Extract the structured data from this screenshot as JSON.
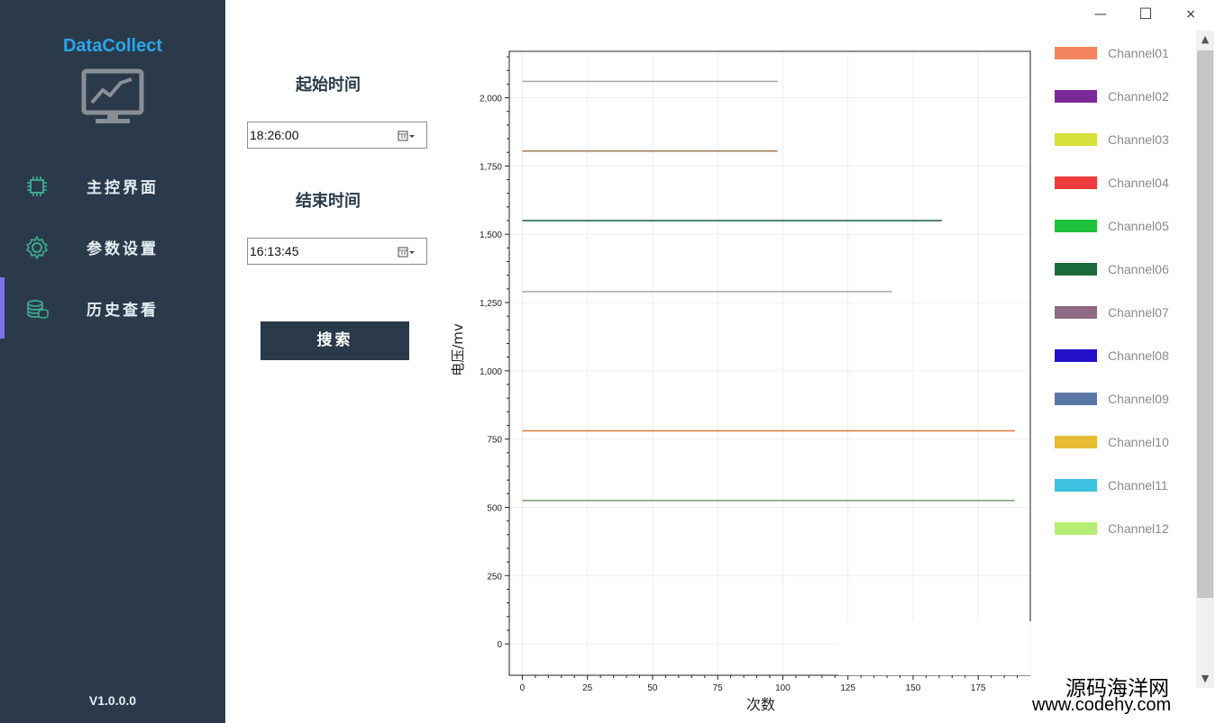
{
  "app": {
    "title": "DataCollect",
    "version": "V1.0.0.0"
  },
  "window": {
    "minimize": "—",
    "maximize": "☐",
    "close": "×"
  },
  "nav": [
    {
      "label": "主控界面",
      "icon": "chip-icon",
      "active": false
    },
    {
      "label": "参数设置",
      "icon": "gear-icon",
      "active": false
    },
    {
      "label": "历史查看",
      "icon": "database-icon",
      "active": true
    }
  ],
  "filter": {
    "start_label": "起始时间",
    "start_value": "18:26:00",
    "end_label": "结束时间",
    "end_value": "16:13:45",
    "search_label": "搜索"
  },
  "chart_data": {
    "type": "line",
    "xlabel": "次数",
    "ylabel": "电压/mv",
    "xlim": [
      -5,
      195
    ],
    "ylim": [
      -115,
      2170
    ],
    "xticks": [
      0,
      25,
      50,
      75,
      100,
      125,
      150,
      175
    ],
    "yticks": [
      0,
      250,
      500,
      750,
      1000,
      1250,
      1500,
      1750,
      2000
    ],
    "ytick_labels": [
      "0",
      "250",
      "500",
      "750",
      "1,000",
      "1,250",
      "1,500",
      "1,750",
      "2,000"
    ],
    "grid": true,
    "series": [
      {
        "color": "#a8a8a8",
        "x": [
          0,
          98
        ],
        "y": [
          2060,
          2060
        ]
      },
      {
        "color": "#a07a5a",
        "x": [
          0,
          98
        ],
        "y": [
          1805,
          1805
        ]
      },
      {
        "color": "#1e5a3a",
        "x": [
          0,
          161
        ],
        "y": [
          1550,
          1550
        ]
      },
      {
        "color": "#a8a8b0",
        "x": [
          0,
          142
        ],
        "y": [
          1290,
          1290
        ]
      },
      {
        "color": "#e0763a",
        "x": [
          0,
          189
        ],
        "y": [
          780,
          780
        ]
      },
      {
        "color": "#7a9a6a",
        "x": [
          0,
          189
        ],
        "y": [
          525,
          525
        ]
      }
    ]
  },
  "legend": [
    {
      "label": "Channel01",
      "color": "#f4845f"
    },
    {
      "label": "Channel02",
      "color": "#7b2a98"
    },
    {
      "label": "Channel03",
      "color": "#d6e13c"
    },
    {
      "label": "Channel04",
      "color": "#ee3a3a"
    },
    {
      "label": "Channel05",
      "color": "#1fc13c"
    },
    {
      "label": "Channel06",
      "color": "#1a6a3c"
    },
    {
      "label": "Channel07",
      "color": "#8e6a84"
    },
    {
      "label": "Channel08",
      "color": "#2410c8"
    },
    {
      "label": "Channel09",
      "color": "#5b77a8"
    },
    {
      "label": "Channel10",
      "color": "#e8bb34"
    },
    {
      "label": "Channel11",
      "color": "#3cc2e0"
    },
    {
      "label": "Channel12",
      "color": "#b6ee74"
    }
  ],
  "watermark": {
    "cn": "源码海洋网",
    "url": "www.codehy.com"
  }
}
